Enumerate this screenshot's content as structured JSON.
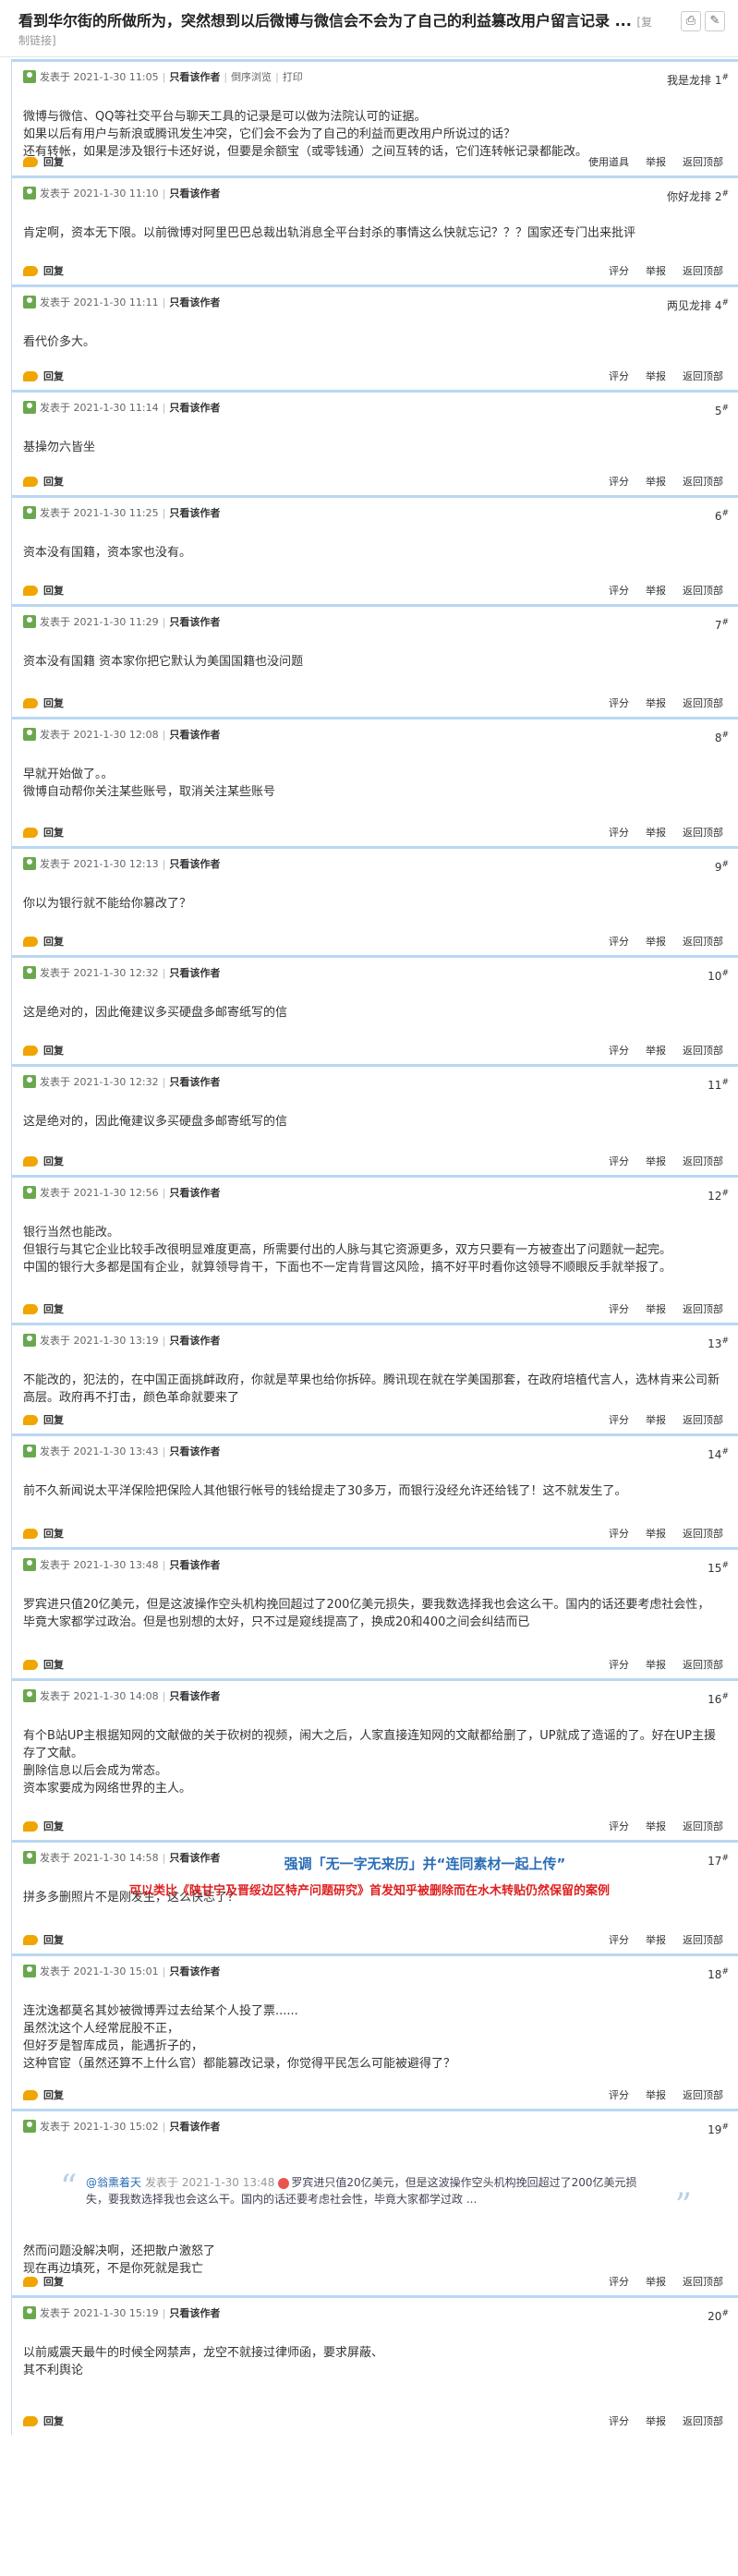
{
  "page": {
    "title": "看到华尔街的所做所为，突然想到以后微博与微信会不会为了自己的利益篡改用户留言记录 ...",
    "title_tag": "[复",
    "copy_link": "制链接]",
    "toolbar_icons": [
      "print-icon",
      "edit-icon"
    ]
  },
  "labels": {
    "posted_at": "发表于",
    "only_author": "只看该作者",
    "reply": "回复",
    "rate": "评分",
    "report": "举报",
    "back_to_top": "返回顶部"
  },
  "colors": {
    "post_top_border": "#b9d7f2",
    "overlay_blue": "#2a6db5",
    "overlay_red": "#e02020"
  },
  "posts": [
    {
      "time": "2021-1-30 11:05",
      "extras": [
        "倒序浏览",
        "打印"
      ],
      "floor_label": "我是龙排",
      "floor": "1",
      "content": "微博与微信、QQ等社交平台与聊天工具的记录是可以做为法院认可的证据。\n如果以后有用户与新浪或腾讯发生冲突，它们会不会为了自己的利益而更改用户所说过的话？\n还有转帐，如果是涉及银行卡还好说，但要是余额宝（或零钱通）之间互转的话，它们连转帐记录都能改。",
      "footer_actions": [
        "使用道具",
        "举报",
        "返回顶部"
      ]
    },
    {
      "time": "2021-1-30 11:10",
      "extras": [],
      "floor_label": "你好龙排",
      "floor": "2",
      "content": "肯定啊，资本无下限。以前微博对阿里巴巴总裁出轨消息全平台封杀的事情这么快就忘记？？？国家还专门出来批评",
      "footer_actions": [
        "评分",
        "举报",
        "返回顶部"
      ]
    },
    {
      "time": "2021-1-30 11:11",
      "extras": [],
      "floor_label": "两见龙排",
      "floor": "4",
      "content": "看代价多大。",
      "footer_actions": [
        "评分",
        "举报",
        "返回顶部"
      ]
    },
    {
      "time": "2021-1-30 11:14",
      "extras": [],
      "floor_label": "",
      "floor": "5",
      "content": "基操勿六皆坐",
      "footer_actions": [
        "评分",
        "举报",
        "返回顶部"
      ]
    },
    {
      "time": "2021-1-30 11:25",
      "extras": [],
      "floor_label": "",
      "floor": "6",
      "content": "资本没有国籍，资本家也没有。",
      "footer_actions": [
        "评分",
        "举报",
        "返回顶部"
      ]
    },
    {
      "time": "2021-1-30 11:29",
      "extras": [],
      "floor_label": "",
      "floor": "7",
      "content": "资本没有国籍 资本家你把它默认为美国国籍也没问题",
      "footer_actions": [
        "评分",
        "举报",
        "返回顶部"
      ]
    },
    {
      "time": "2021-1-30 12:08",
      "extras": [],
      "floor_label": "",
      "floor": "8",
      "content": "早就开始做了。。\n微博自动帮你关注某些账号，取消关注某些账号",
      "footer_actions": [
        "评分",
        "举报",
        "返回顶部"
      ]
    },
    {
      "time": "2021-1-30 12:13",
      "extras": [],
      "floor_label": "",
      "floor": "9",
      "content": "你以为银行就不能给你篡改了？",
      "footer_actions": [
        "评分",
        "举报",
        "返回顶部"
      ]
    },
    {
      "time": "2021-1-30 12:32",
      "extras": [],
      "floor_label": "",
      "floor": "10",
      "content": "这是绝对的，因此俺建议多买硬盘多邮寄纸写的信",
      "footer_actions": [
        "评分",
        "举报",
        "返回顶部"
      ]
    },
    {
      "time": "2021-1-30 12:32",
      "extras": [],
      "floor_label": "",
      "floor": "11",
      "content": "这是绝对的，因此俺建议多买硬盘多邮寄纸写的信",
      "footer_actions": [
        "评分",
        "举报",
        "返回顶部"
      ]
    },
    {
      "time": "2021-1-30 12:56",
      "extras": [],
      "floor_label": "",
      "floor": "12",
      "content": "银行当然也能改。\n但银行与其它企业比较手改很明显难度更高，所需要付出的人脉与其它资源更多，双方只要有一方被查出了问题就一起完。\n中国的银行大多都是国有企业，就算领导肯干，下面也不一定肯背冒这风险，搞不好平时看你这领导不顺眼反手就举报了。",
      "footer_actions": [
        "评分",
        "举报",
        "返回顶部"
      ]
    },
    {
      "time": "2021-1-30 13:19",
      "extras": [],
      "floor_label": "",
      "floor": "13",
      "content": "不能改的，犯法的，在中国正面挑衅政府，你就是苹果也给你拆碎。腾讯现在就在学美国那套，在政府培植代言人，选林肯来公司新高层。政府再不打击，颜色革命就要来了",
      "footer_actions": [
        "评分",
        "举报",
        "返回顶部"
      ]
    },
    {
      "time": "2021-1-30 13:43",
      "extras": [],
      "floor_label": "",
      "floor": "14",
      "content": "前不久新闻说太平洋保险把保险人其他银行帐号的钱给提走了30多万，而银行没经允许还给钱了！这不就发生了。",
      "footer_actions": [
        "评分",
        "举报",
        "返回顶部"
      ]
    },
    {
      "time": "2021-1-30 13:48",
      "extras": [],
      "floor_label": "",
      "floor": "15",
      "content": "罗宾进只值20亿美元，但是这波操作空头机构挽回超过了200亿美元损失，要我数选择我也会这么干。国内的话还要考虑社会性，毕竟大家都学过政治。但是也别想的太好，只不过是窥线提高了，换成20和400之间会纠结而已",
      "footer_actions": [
        "评分",
        "举报",
        "返回顶部"
      ]
    },
    {
      "time": "2021-1-30 14:08",
      "extras": [],
      "floor_label": "",
      "floor": "16",
      "content": "有个B站UP主根据知网的文献做的关于砍树的视频，闹大之后，人家直接连知网的文献都给删了，UP就成了造谣的了。好在UP主援存了文献。\n删除信息以后会成为常态。\n资本家要成为网络世界的主人。",
      "footer_actions": [
        "评分",
        "举报",
        "返回顶部"
      ]
    },
    {
      "time": "2021-1-30 14:58",
      "extras": [],
      "floor_label": "",
      "floor": "17",
      "content": "拼多多删照片不是刚发生，这么快忘了？",
      "footer_actions": [
        "评分",
        "举报",
        "返回顶部"
      ]
    },
    {
      "time": "2021-1-30 15:01",
      "extras": [],
      "floor_label": "",
      "floor": "18",
      "content": "连沈逸都莫名其妙被微博弄过去给某个人投了票......\n虽然沈这个人经常屁股不正，\n但好歹是智库成员，能遇折子的，\n这种官宦（虽然还算不上什么官）都能篡改记录，你觉得平民怎么可能被避得了？",
      "footer_actions": [
        "评分",
        "举报",
        "返回顶部"
      ]
    },
    {
      "time": "2021-1-30 15:02",
      "extras": [],
      "floor_label": "",
      "floor": "19",
      "content": "然而问题没解决啊，还把散户激怒了\n现在再边填死，不是你死就是我亡",
      "footer_actions": [
        "评分",
        "举报",
        "返回顶部"
      ],
      "quote": {
        "user": "@翁熏着天",
        "posted": "发表于 2021-1-30 13:48",
        "text": "罗宾进只值20亿美元，但是这波操作空头机构挽回超过了200亿美元损失，要我数选择我也会这么干。国内的话还要考虑社会性，毕竟大家都学过政 ..."
      }
    },
    {
      "time": "2021-1-30 15:19",
      "extras": [],
      "floor_label": "",
      "floor": "20",
      "content": "以前威震天最牛的时候全网禁声，龙空不就接过律师函，要求屏蔽、\n其不利舆论",
      "footer_actions": [
        "评分",
        "举报",
        "返回顶部"
      ]
    }
  ],
  "overlays": {
    "line1": "强调「无一字无来历」并“连同素材一起上传”",
    "line2": "可以类比《陕甘宁及晋绥边区特产问题研究》首发知乎被删除而在水木转贴仍然保留的案例"
  }
}
